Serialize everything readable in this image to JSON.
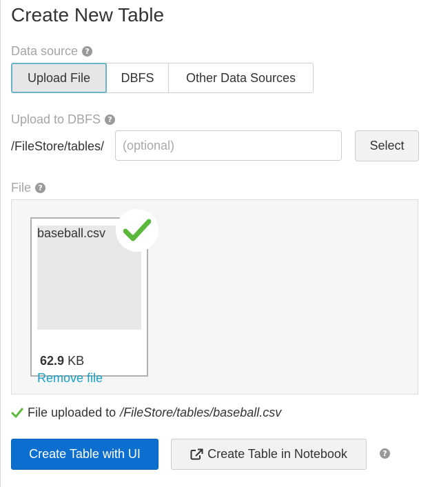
{
  "page": {
    "title": "Create New Table"
  },
  "data_source": {
    "label": "Data source",
    "tabs": [
      {
        "label": "Upload File",
        "active": true
      },
      {
        "label": "DBFS",
        "active": false
      },
      {
        "label": "Other Data Sources",
        "active": false
      }
    ]
  },
  "upload_to_dbfs": {
    "label": "Upload to DBFS",
    "prefix": "/FileStore/tables/",
    "placeholder": "(optional)",
    "value": "",
    "select_label": "Select"
  },
  "file": {
    "label": "File",
    "name": "baseball.csv",
    "size_value": "62.9",
    "size_unit": "KB",
    "remove_label": "Remove file",
    "upload_complete": true
  },
  "status": {
    "prefix": "File uploaded to",
    "path": "/FileStore/tables/baseball.csv"
  },
  "actions": {
    "create_ui_label": "Create Table with UI",
    "create_notebook_label": "Create Table in Notebook"
  },
  "help_glyph": "?",
  "colors": {
    "primary": "#0c6fd0",
    "link": "#1a9fc4",
    "success": "#5cb83c",
    "active_tab_border": "#69b3c6"
  }
}
